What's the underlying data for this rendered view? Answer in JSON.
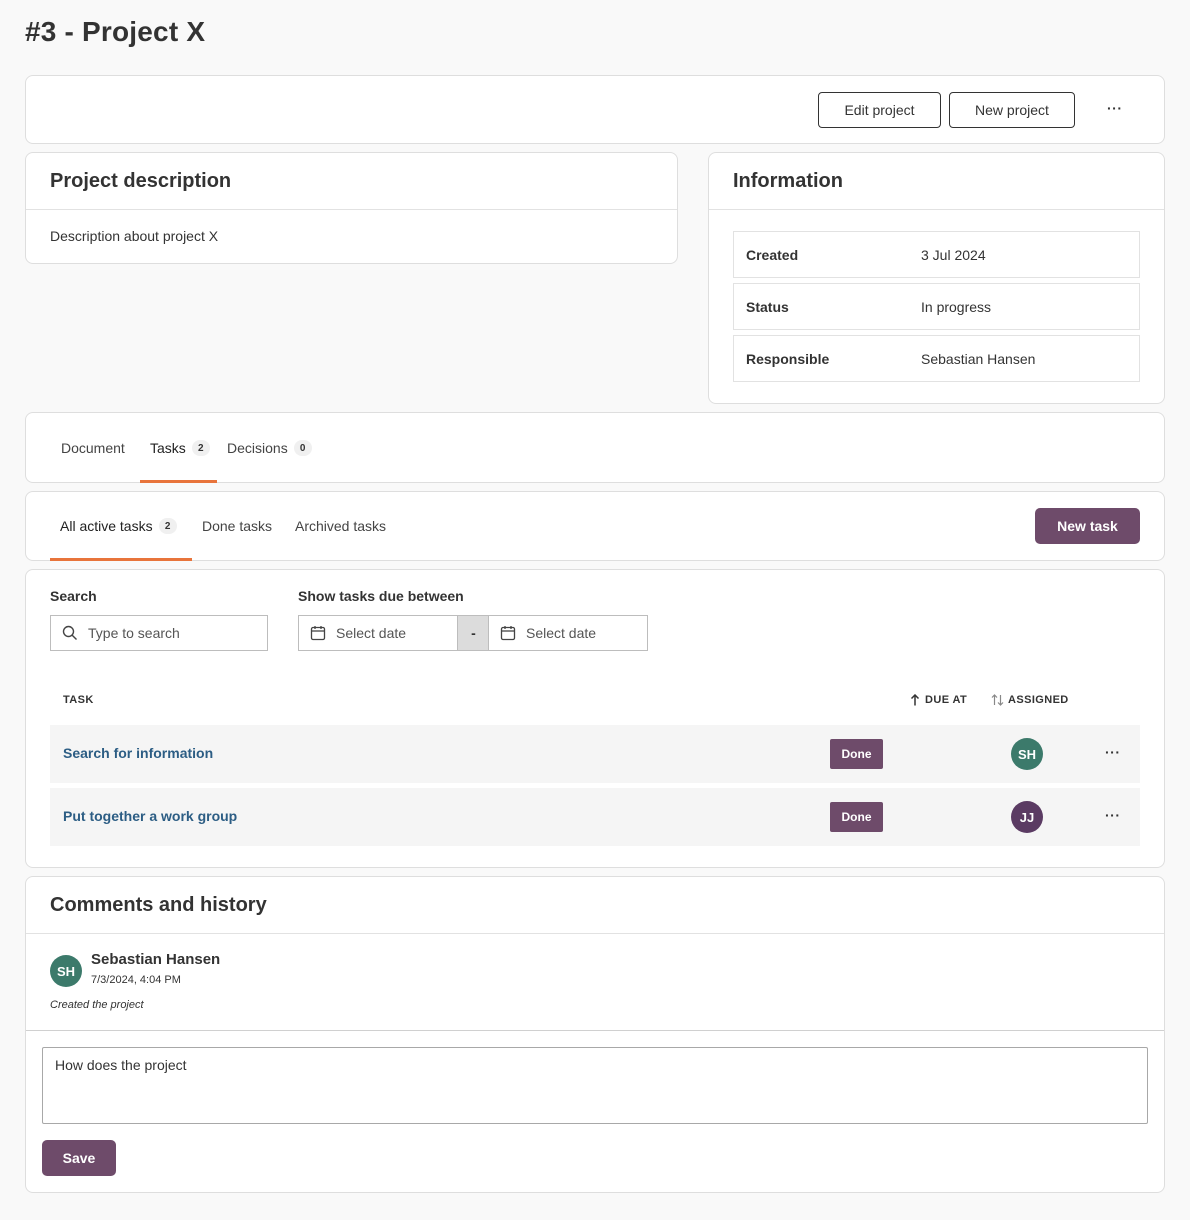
{
  "page": {
    "title": "#3 - Project X"
  },
  "toolbar": {
    "edit_label": "Edit project",
    "new_label": "New project",
    "more_label": "···"
  },
  "description": {
    "title": "Project description",
    "text": "Description about project X"
  },
  "information": {
    "title": "Information",
    "rows": [
      {
        "key": "Created",
        "value": "3 Jul 2024"
      },
      {
        "key": "Status",
        "value": "In progress"
      },
      {
        "key": "Responsible",
        "value": "Sebastian Hansen"
      }
    ]
  },
  "main_tabs": [
    {
      "label": "Document",
      "count": null,
      "active": false
    },
    {
      "label": "Tasks",
      "count": "2",
      "active": true
    },
    {
      "label": "Decisions",
      "count": "0",
      "active": false
    }
  ],
  "sub_tabs": [
    {
      "label": "All active tasks",
      "count": "2",
      "active": true
    },
    {
      "label": "Done tasks",
      "count": null,
      "active": false
    },
    {
      "label": "Archived tasks",
      "count": null,
      "active": false
    }
  ],
  "new_task_label": "New task",
  "filters": {
    "search_label": "Search",
    "search_placeholder": "Type to search",
    "date_label": "Show tasks due between",
    "date_from_placeholder": "Select date",
    "date_separator": "-",
    "date_to_placeholder": "Select date"
  },
  "table": {
    "col_task": "TASK",
    "col_due": "DUE AT",
    "col_assigned": "ASSIGNED",
    "rows": [
      {
        "task": "Search for information",
        "status": "Done",
        "assignee_initials": "SH",
        "assignee_color": "#3c7a6b",
        "more": "···"
      },
      {
        "task": "Put together a work group",
        "status": "Done",
        "assignee_initials": "JJ",
        "assignee_color": "#5b3b63",
        "more": "···"
      }
    ]
  },
  "comments": {
    "title": "Comments and history",
    "entries": [
      {
        "initials": "SH",
        "avatar_color": "#3c7a6b",
        "author": "Sebastian Hansen",
        "date": "7/3/2024, 4:04 PM",
        "text": "Created the project"
      }
    ],
    "input_value": "How does the project",
    "save_label": "Save"
  },
  "colors": {
    "accent_tab": "#e8743b",
    "primary_button": "#6e4b6a",
    "link": "#2c5d84"
  }
}
